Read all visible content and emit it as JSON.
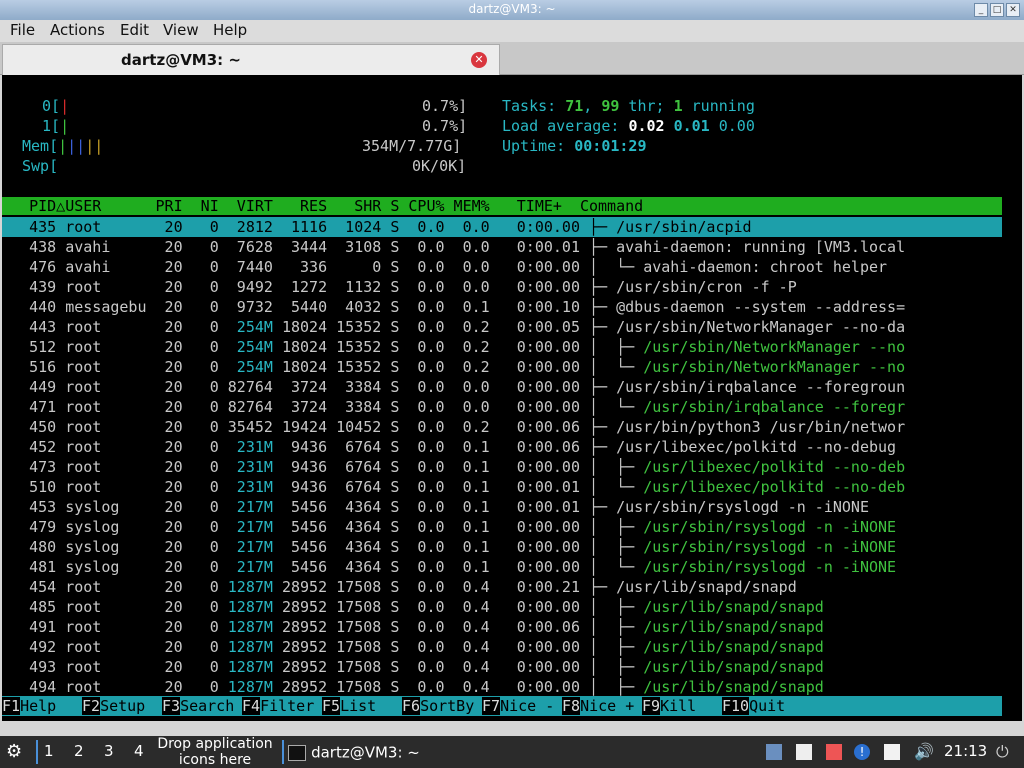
{
  "window": {
    "title": "dartz@VM3: ~"
  },
  "menubar": {
    "items": [
      "File",
      "Actions",
      "Edit",
      "View",
      "Help"
    ]
  },
  "tab": {
    "label": "dartz@VM3: ~"
  },
  "meters": {
    "cpu0_label": "0[",
    "cpu0_bar": "|",
    "cpu0_value": "0.7%]",
    "cpu1_label": "1[",
    "cpu1_bar": "|",
    "cpu1_value": "0.7%]",
    "mem_label": "Mem[",
    "mem_bar": "|||||",
    "mem_value": "354M/7.77G]",
    "swp_label": "Swp[",
    "swp_value": "0K/0K]"
  },
  "stats": {
    "tasks_label": "Tasks: ",
    "tasks_count": "71",
    "tasks_sep": ", ",
    "threads_count": "99",
    "threads_label": " thr; ",
    "running_count": "1",
    "running_label": " running",
    "load_label": "Load average: ",
    "load1": "0.02",
    "load5": "0.01",
    "load15": "0.00",
    "uptime_label": "Uptime: ",
    "uptime_value": "00:01:29"
  },
  "header": "   PID△USER      PRI  NI  VIRT   RES   SHR S CPU% MEM%   TIME+  Command",
  "processes": [
    {
      "pid": "435",
      "user": "root",
      "pri": "20",
      "ni": "0",
      "virt": "2812",
      "res": "1116",
      "shr": "1024",
      "s": "S",
      "cpu": "0.0",
      "mem": "0.0",
      "time": "0:00.00",
      "tree": "├─ ",
      "cmd": "/usr/sbin/acpid",
      "thread": false
    },
    {
      "pid": "438",
      "user": "avahi",
      "pri": "20",
      "ni": "0",
      "virt": "7628",
      "res": "3444",
      "shr": "3108",
      "s": "S",
      "cpu": "0.0",
      "mem": "0.0",
      "time": "0:00.01",
      "tree": "├─ ",
      "cmd": "avahi-daemon: running [VM3.local",
      "thread": false
    },
    {
      "pid": "476",
      "user": "avahi",
      "pri": "20",
      "ni": "0",
      "virt": "7440",
      "res": "336",
      "shr": "0",
      "s": "S",
      "cpu": "0.0",
      "mem": "0.0",
      "time": "0:00.00",
      "tree": "│  └─ ",
      "cmd": "avahi-daemon: chroot helper",
      "thread": false
    },
    {
      "pid": "439",
      "user": "root",
      "pri": "20",
      "ni": "0",
      "virt": "9492",
      "res": "1272",
      "shr": "1132",
      "s": "S",
      "cpu": "0.0",
      "mem": "0.0",
      "time": "0:00.00",
      "tree": "├─ ",
      "cmd": "/usr/sbin/cron -f -P",
      "thread": false
    },
    {
      "pid": "440",
      "user": "messagebu",
      "pri": "20",
      "ni": "0",
      "virt": "9732",
      "res": "5440",
      "shr": "4032",
      "s": "S",
      "cpu": "0.0",
      "mem": "0.1",
      "time": "0:00.10",
      "tree": "├─ ",
      "cmd": "@dbus-daemon --system --address=",
      "thread": false
    },
    {
      "pid": "443",
      "user": "root",
      "pri": "20",
      "ni": "0",
      "virt": "254M",
      "res": "18024",
      "shr": "15352",
      "s": "S",
      "cpu": "0.0",
      "mem": "0.2",
      "time": "0:00.05",
      "tree": "├─ ",
      "cmd": "/usr/sbin/NetworkManager --no-da",
      "thread": false
    },
    {
      "pid": "512",
      "user": "root",
      "pri": "20",
      "ni": "0",
      "virt": "254M",
      "res": "18024",
      "shr": "15352",
      "s": "S",
      "cpu": "0.0",
      "mem": "0.2",
      "time": "0:00.00",
      "tree": "│  ├─ ",
      "cmd": "/usr/sbin/NetworkManager --no",
      "thread": true
    },
    {
      "pid": "516",
      "user": "root",
      "pri": "20",
      "ni": "0",
      "virt": "254M",
      "res": "18024",
      "shr": "15352",
      "s": "S",
      "cpu": "0.0",
      "mem": "0.2",
      "time": "0:00.00",
      "tree": "│  └─ ",
      "cmd": "/usr/sbin/NetworkManager --no",
      "thread": true
    },
    {
      "pid": "449",
      "user": "root",
      "pri": "20",
      "ni": "0",
      "virt": "82764",
      "res": "3724",
      "shr": "3384",
      "s": "S",
      "cpu": "0.0",
      "mem": "0.0",
      "time": "0:00.00",
      "tree": "├─ ",
      "cmd": "/usr/sbin/irqbalance --foregroun",
      "thread": false
    },
    {
      "pid": "471",
      "user": "root",
      "pri": "20",
      "ni": "0",
      "virt": "82764",
      "res": "3724",
      "shr": "3384",
      "s": "S",
      "cpu": "0.0",
      "mem": "0.0",
      "time": "0:00.00",
      "tree": "│  └─ ",
      "cmd": "/usr/sbin/irqbalance --foregr",
      "thread": true
    },
    {
      "pid": "450",
      "user": "root",
      "pri": "20",
      "ni": "0",
      "virt": "35452",
      "res": "19424",
      "shr": "10452",
      "s": "S",
      "cpu": "0.0",
      "mem": "0.2",
      "time": "0:00.06",
      "tree": "├─ ",
      "cmd": "/usr/bin/python3 /usr/bin/networ",
      "thread": false
    },
    {
      "pid": "452",
      "user": "root",
      "pri": "20",
      "ni": "0",
      "virt": "231M",
      "res": "9436",
      "shr": "6764",
      "s": "S",
      "cpu": "0.0",
      "mem": "0.1",
      "time": "0:00.06",
      "tree": "├─ ",
      "cmd": "/usr/libexec/polkitd --no-debug",
      "thread": false
    },
    {
      "pid": "473",
      "user": "root",
      "pri": "20",
      "ni": "0",
      "virt": "231M",
      "res": "9436",
      "shr": "6764",
      "s": "S",
      "cpu": "0.0",
      "mem": "0.1",
      "time": "0:00.00",
      "tree": "│  ├─ ",
      "cmd": "/usr/libexec/polkitd --no-deb",
      "thread": true
    },
    {
      "pid": "510",
      "user": "root",
      "pri": "20",
      "ni": "0",
      "virt": "231M",
      "res": "9436",
      "shr": "6764",
      "s": "S",
      "cpu": "0.0",
      "mem": "0.1",
      "time": "0:00.01",
      "tree": "│  └─ ",
      "cmd": "/usr/libexec/polkitd --no-deb",
      "thread": true
    },
    {
      "pid": "453",
      "user": "syslog",
      "pri": "20",
      "ni": "0",
      "virt": "217M",
      "res": "5456",
      "shr": "4364",
      "s": "S",
      "cpu": "0.0",
      "mem": "0.1",
      "time": "0:00.01",
      "tree": "├─ ",
      "cmd": "/usr/sbin/rsyslogd -n -iNONE",
      "thread": false
    },
    {
      "pid": "479",
      "user": "syslog",
      "pri": "20",
      "ni": "0",
      "virt": "217M",
      "res": "5456",
      "shr": "4364",
      "s": "S",
      "cpu": "0.0",
      "mem": "0.1",
      "time": "0:00.00",
      "tree": "│  ├─ ",
      "cmd": "/usr/sbin/rsyslogd -n -iNONE",
      "thread": true
    },
    {
      "pid": "480",
      "user": "syslog",
      "pri": "20",
      "ni": "0",
      "virt": "217M",
      "res": "5456",
      "shr": "4364",
      "s": "S",
      "cpu": "0.0",
      "mem": "0.1",
      "time": "0:00.00",
      "tree": "│  ├─ ",
      "cmd": "/usr/sbin/rsyslogd -n -iNONE",
      "thread": true
    },
    {
      "pid": "481",
      "user": "syslog",
      "pri": "20",
      "ni": "0",
      "virt": "217M",
      "res": "5456",
      "shr": "4364",
      "s": "S",
      "cpu": "0.0",
      "mem": "0.1",
      "time": "0:00.00",
      "tree": "│  └─ ",
      "cmd": "/usr/sbin/rsyslogd -n -iNONE",
      "thread": true
    },
    {
      "pid": "454",
      "user": "root",
      "pri": "20",
      "ni": "0",
      "virt": "1287M",
      "res": "28952",
      "shr": "17508",
      "s": "S",
      "cpu": "0.0",
      "mem": "0.4",
      "time": "0:00.21",
      "tree": "├─ ",
      "cmd": "/usr/lib/snapd/snapd",
      "thread": false
    },
    {
      "pid": "485",
      "user": "root",
      "pri": "20",
      "ni": "0",
      "virt": "1287M",
      "res": "28952",
      "shr": "17508",
      "s": "S",
      "cpu": "0.0",
      "mem": "0.4",
      "time": "0:00.00",
      "tree": "│  ├─ ",
      "cmd": "/usr/lib/snapd/snapd",
      "thread": true
    },
    {
      "pid": "491",
      "user": "root",
      "pri": "20",
      "ni": "0",
      "virt": "1287M",
      "res": "28952",
      "shr": "17508",
      "s": "S",
      "cpu": "0.0",
      "mem": "0.4",
      "time": "0:00.06",
      "tree": "│  ├─ ",
      "cmd": "/usr/lib/snapd/snapd",
      "thread": true
    },
    {
      "pid": "492",
      "user": "root",
      "pri": "20",
      "ni": "0",
      "virt": "1287M",
      "res": "28952",
      "shr": "17508",
      "s": "S",
      "cpu": "0.0",
      "mem": "0.4",
      "time": "0:00.00",
      "tree": "│  ├─ ",
      "cmd": "/usr/lib/snapd/snapd",
      "thread": true
    },
    {
      "pid": "493",
      "user": "root",
      "pri": "20",
      "ni": "0",
      "virt": "1287M",
      "res": "28952",
      "shr": "17508",
      "s": "S",
      "cpu": "0.0",
      "mem": "0.4",
      "time": "0:00.00",
      "tree": "│  ├─ ",
      "cmd": "/usr/lib/snapd/snapd",
      "thread": true
    },
    {
      "pid": "494",
      "user": "root",
      "pri": "20",
      "ni": "0",
      "virt": "1287M",
      "res": "28952",
      "shr": "17508",
      "s": "S",
      "cpu": "0.0",
      "mem": "0.4",
      "time": "0:00.00",
      "tree": "│  ├─ ",
      "cmd": "/usr/lib/snapd/snapd",
      "thread": true
    }
  ],
  "fkeys": [
    {
      "num": "F1",
      "label": "Help  "
    },
    {
      "num": "F2",
      "label": "Setup "
    },
    {
      "num": "F3",
      "label": "Search"
    },
    {
      "num": "F4",
      "label": "Filter"
    },
    {
      "num": "F5",
      "label": "List  "
    },
    {
      "num": "F6",
      "label": "SortBy"
    },
    {
      "num": "F7",
      "label": "Nice -"
    },
    {
      "num": "F8",
      "label": "Nice +"
    },
    {
      "num": "F9",
      "label": "Kill  "
    },
    {
      "num": "F10",
      "label": "Quit "
    }
  ],
  "taskbar": {
    "workspaces": [
      "1",
      "2",
      "3",
      "4"
    ],
    "drop_label_line1": "Drop application",
    "drop_label_line2": "icons here",
    "task_label": "dartz@VM3: ~",
    "clock": "21:13"
  },
  "colors": {
    "cyan": "#29b8c4",
    "value_white": "#ffffff",
    "green_thread": "#3fc23f",
    "meter_red": "#d42a2a",
    "meter_green": "#3fc23f",
    "meter_blue": "#3a5fd9",
    "meter_yellow": "#c9a227",
    "gray_text": "#c8c8c8",
    "header_green": "#1fad1f",
    "selected_cyan": "#1d9faa"
  }
}
